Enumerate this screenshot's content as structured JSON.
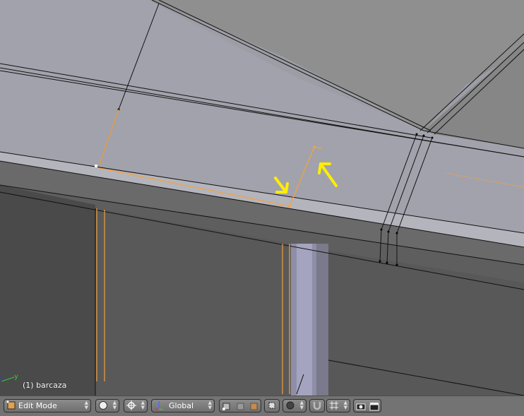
{
  "viewport": {
    "object_label": "(1) barcaza",
    "axis_y_label": "y"
  },
  "header": {
    "mode_label": "Edit Mode",
    "transform_orientation": "Global",
    "icons": {
      "editor_type": "mesh-edit-icon",
      "viewport_shading": "solid-sphere-icon",
      "pivot_point": "pivot-point-icon",
      "manipulator": "manipulator-icon",
      "select_vertex": "vertex-select-icon",
      "select_edge": "edge-select-icon",
      "select_face": "face-select-icon",
      "occlude": "occlude-geometry-icon",
      "proportional": "proportional-editing-icon",
      "snap": "magnet-icon",
      "snap_element": "snap-increment-icon",
      "render_opengl": "camera-icon",
      "render_anim": "clapper-icon"
    },
    "colors": {
      "header_bg": "#737373",
      "accent_orange": "#f5a23a",
      "annotation_yellow": "#ffee00"
    }
  }
}
